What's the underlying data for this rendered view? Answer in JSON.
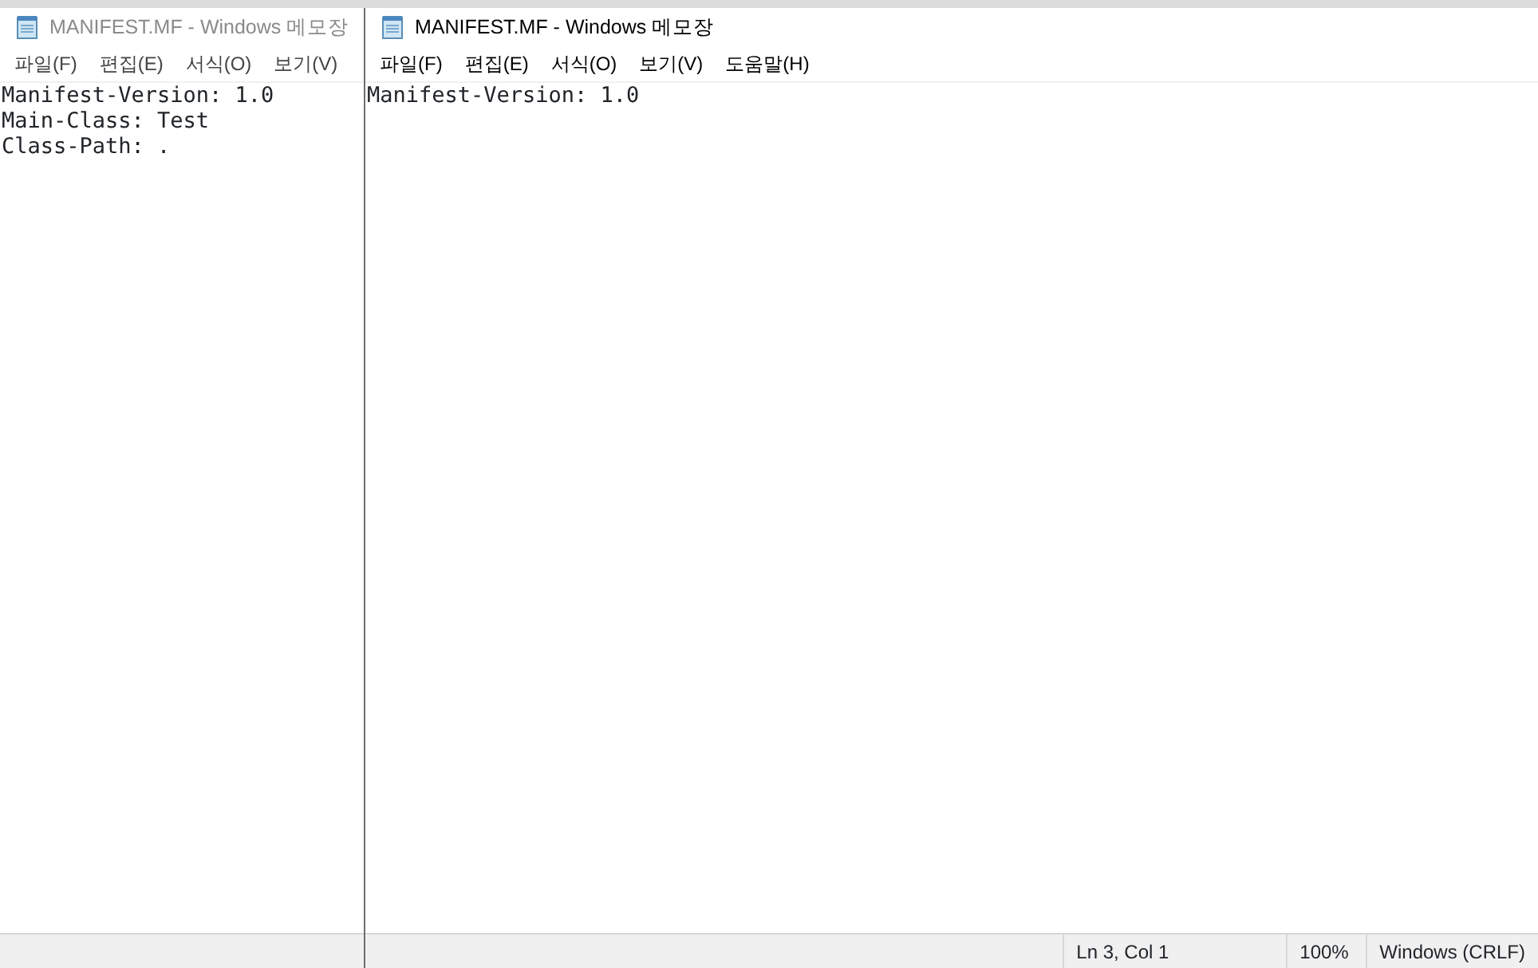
{
  "windows": [
    {
      "title": "MANIFEST.MF - Windows 메모장",
      "active": false,
      "menu": [
        "파일(F)",
        "편집(E)",
        "서식(O)",
        "보기(V)"
      ],
      "lines": [
        "Manifest-Version: 1.0",
        "Main-Class: Test",
        "Class-Path: ."
      ]
    },
    {
      "title": "MANIFEST.MF - Windows 메모장",
      "active": true,
      "menu": [
        "파일(F)",
        "편집(E)",
        "서식(O)",
        "보기(V)",
        "도움말(H)"
      ],
      "lines": [
        "Manifest-Version: 1.0"
      ],
      "status_bar": {
        "position": "Ln 3, Col 1",
        "zoom": "100%",
        "line_ending": "Windows (CRLF)"
      }
    }
  ]
}
